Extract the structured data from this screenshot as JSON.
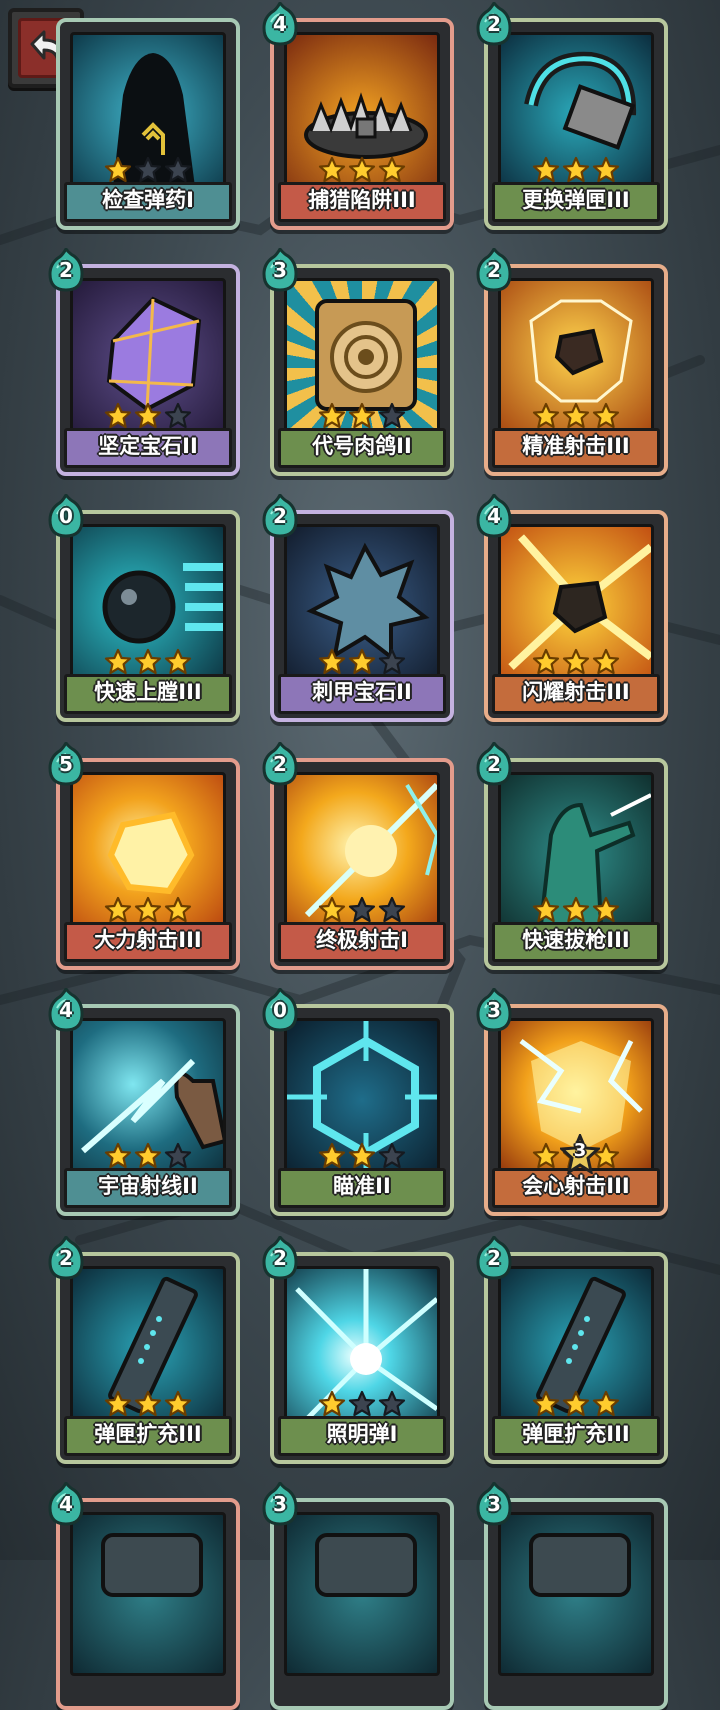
{
  "back_button": {
    "icon": "back-arrow-icon"
  },
  "colors": {
    "label_teal": "#4f8f93",
    "label_red": "#c45a48",
    "label_green": "#6d8f4e",
    "label_purple": "#8d76b8",
    "label_orange": "#c46c3c",
    "border_teal": "#a7c9b4",
    "border_red": "#e39c8c",
    "border_green": "#b7c79d",
    "border_purple": "#c4b2e0",
    "border_orange": "#e7ad8a"
  },
  "cards": [
    {
      "name": "检查弹药I",
      "cost": "",
      "stars": 1,
      "theme": "teal",
      "art": "shadow-figure"
    },
    {
      "name": "捕猎陷阱III",
      "cost": "4",
      "stars": 3,
      "theme": "red",
      "art": "bear-trap"
    },
    {
      "name": "更换弹匣III",
      "cost": "2",
      "stars": 3,
      "theme": "green",
      "art": "magazine-swap"
    },
    {
      "name": "坚定宝石II",
      "cost": "2",
      "stars": 2,
      "theme": "purple",
      "art": "purple-gem"
    },
    {
      "name": "代号肉鸽II",
      "cost": "3",
      "stars": 2,
      "theme": "green",
      "art": "gold-vault"
    },
    {
      "name": "精准射击III",
      "cost": "2",
      "stars": 3,
      "theme": "orange",
      "art": "precise-shot"
    },
    {
      "name": "快速上膛III",
      "cost": "0",
      "stars": 3,
      "theme": "green",
      "art": "fast-bullet"
    },
    {
      "name": "刺甲宝石II",
      "cost": "2",
      "stars": 2,
      "theme": "purple",
      "art": "spike-gem"
    },
    {
      "name": "闪耀射击III",
      "cost": "4",
      "stars": 3,
      "theme": "orange",
      "art": "shining-shot"
    },
    {
      "name": "大力射击III",
      "cost": "5",
      "stars": 3,
      "theme": "red",
      "art": "power-shot"
    },
    {
      "name": "终极射击I",
      "cost": "2",
      "stars": 1,
      "theme": "red",
      "art": "ultimate-shot"
    },
    {
      "name": "快速拔枪III",
      "cost": "2",
      "stars": 3,
      "theme": "green",
      "art": "quick-draw"
    },
    {
      "name": "宇宙射线II",
      "cost": "4",
      "stars": 2,
      "theme": "teal",
      "art": "cosmic-ray"
    },
    {
      "name": "瞄准II",
      "cost": "0",
      "stars": 2,
      "theme": "green",
      "art": "aim-hexagon"
    },
    {
      "name": "会心射击III",
      "cost": "3",
      "stars": 3,
      "theme": "orange",
      "art": "critical-shot",
      "badge": "3"
    },
    {
      "name": "弹匣扩充III",
      "cost": "2",
      "stars": 3,
      "theme": "green",
      "art": "mag-extend"
    },
    {
      "name": "照明弹I",
      "cost": "2",
      "stars": 1,
      "theme": "green",
      "art": "flare"
    },
    {
      "name": "弹匣扩充III",
      "cost": "2",
      "stars": 3,
      "theme": "green",
      "art": "mag-extend"
    },
    {
      "name": "",
      "cost": "4",
      "stars": 0,
      "theme": "red",
      "art": "partial"
    },
    {
      "name": "",
      "cost": "3",
      "stars": 0,
      "theme": "teal",
      "art": "partial"
    },
    {
      "name": "",
      "cost": "3",
      "stars": 0,
      "theme": "teal",
      "art": "partial"
    }
  ]
}
